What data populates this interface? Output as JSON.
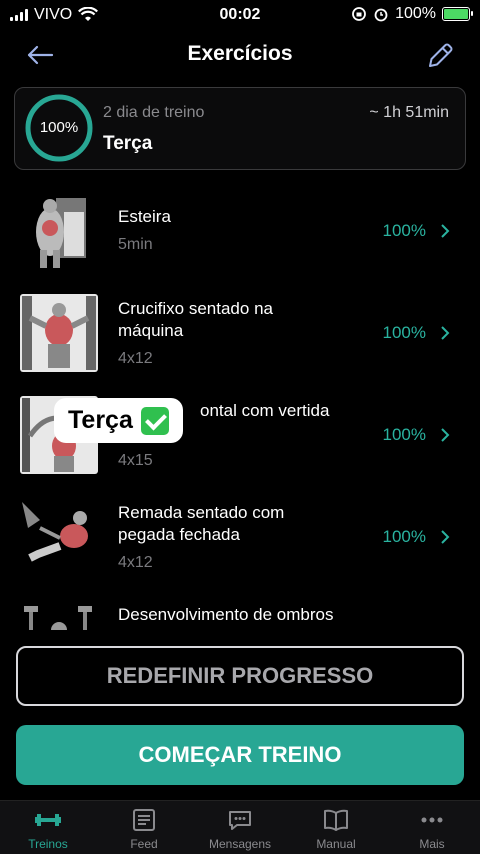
{
  "status_bar": {
    "carrier": "VIVO",
    "time": "00:02",
    "battery": "100%"
  },
  "header": {
    "title": "Exercícios"
  },
  "summary": {
    "progress": "100%",
    "subtitle": "2 dia de treino",
    "day": "Terça",
    "duration": "~ 1h 51min"
  },
  "exercises": [
    {
      "name": "Esteira",
      "detail": "5min",
      "progress": "100%"
    },
    {
      "name": "Crucifixo sentado na máquina",
      "detail": "4x12",
      "progress": "100%"
    },
    {
      "name": "Elevação frontal com pegada invertida",
      "name_visible": "ontal com vertida",
      "detail": "4x15",
      "progress": "100%"
    },
    {
      "name": "Remada sentado com pegada fechada",
      "detail": "4x12",
      "progress": "100%"
    },
    {
      "name": "Desenvolvimento de ombros",
      "detail": "",
      "progress": ""
    }
  ],
  "overlay_label": "Terça",
  "buttons": {
    "reset": "REDEFINIR PROGRESSO",
    "start": "COMEÇAR TREINO"
  },
  "tabs": [
    {
      "label": "Treinos",
      "icon": "dumbbell-icon",
      "active": true
    },
    {
      "label": "Feed",
      "icon": "feed-icon",
      "active": false
    },
    {
      "label": "Mensagens",
      "icon": "chat-icon",
      "active": false
    },
    {
      "label": "Manual",
      "icon": "book-icon",
      "active": false
    },
    {
      "label": "Mais",
      "icon": "more-icon",
      "active": false
    }
  ],
  "colors": {
    "accent": "#28a794",
    "background": "#000000",
    "muted": "#8a8a8e"
  }
}
